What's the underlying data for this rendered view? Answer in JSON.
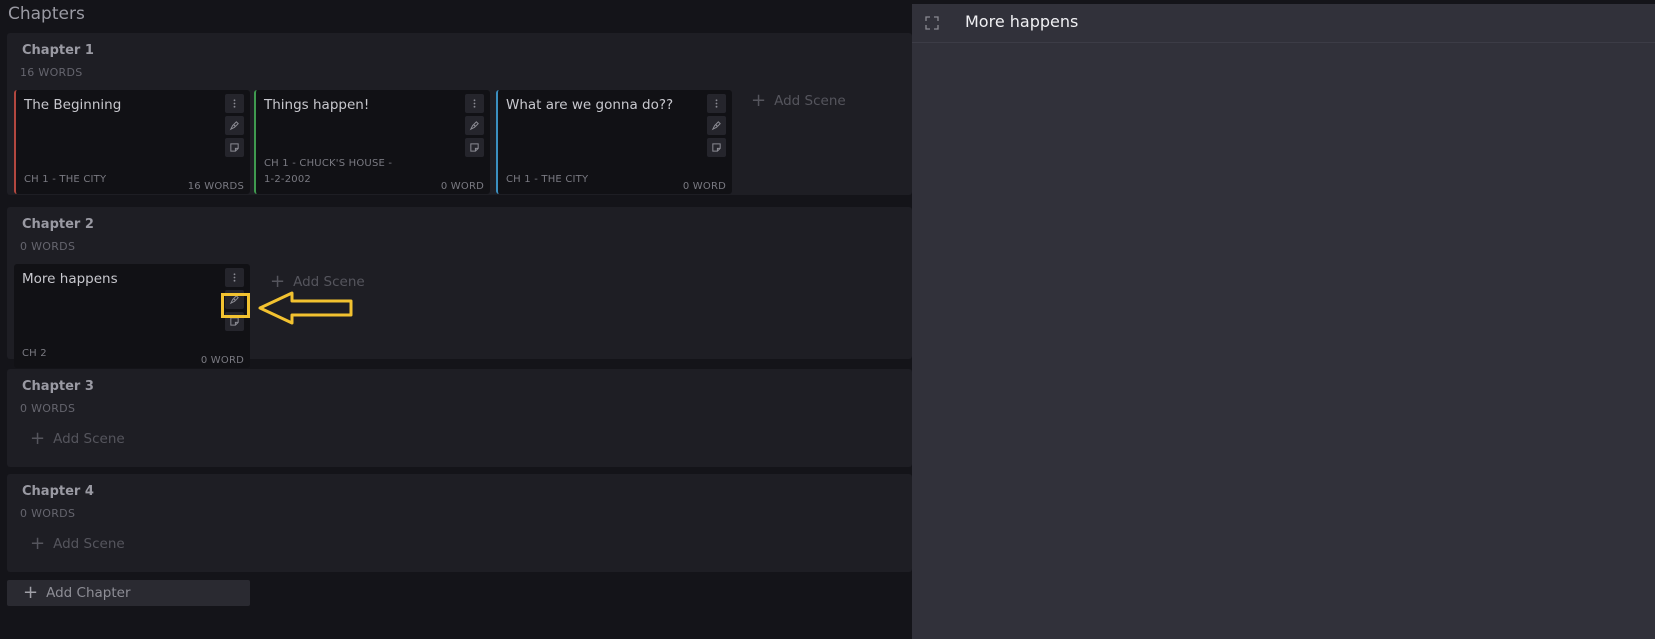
{
  "page_title": "Chapters",
  "chapters": [
    {
      "title": "Chapter 1",
      "words": "16 WORDS",
      "scenes": [
        {
          "title": "The Beginning",
          "meta_line1": "",
          "meta_line2": "CH 1 - THE CITY",
          "count": "16 WORDS",
          "stripe_color": "#b2473f"
        },
        {
          "title": "Things happen!",
          "meta_line1": "CH 1 - CHUCK'S HOUSE -",
          "meta_line2": "1-2-2002",
          "count": "0 WORD",
          "stripe_color": "#3f9a4f"
        },
        {
          "title": "What are we gonna do??",
          "meta_line1": "",
          "meta_line2": "CH 1 - THE CITY",
          "count": "0 WORD",
          "stripe_color": "#3b8fc0"
        }
      ],
      "add_scene_label": "Add Scene"
    },
    {
      "title": "Chapter 2",
      "words": "0 WORDS",
      "scenes": [
        {
          "title": "More happens",
          "meta_line1": "",
          "meta_line2": "CH 2",
          "count": "0 WORD",
          "stripe_color": ""
        }
      ],
      "add_scene_label": "Add Scene"
    },
    {
      "title": "Chapter 3",
      "words": "0 WORDS",
      "scenes": [],
      "add_scene_label": "Add Scene"
    },
    {
      "title": "Chapter 4",
      "words": "0 WORDS",
      "scenes": [],
      "add_scene_label": "Add Scene"
    }
  ],
  "add_chapter_label": "Add Chapter",
  "panel": {
    "title": "More happens"
  },
  "icons": {
    "menu": "more-vertical-icon",
    "pov": "pen-nib-icon",
    "notes": "sticky-note-icon",
    "expand": "expand-icon",
    "plus": "plus-icon"
  },
  "colors": {
    "highlight": "#f2c230",
    "panel_bg": "#31313a",
    "page_bg": "#141419"
  }
}
